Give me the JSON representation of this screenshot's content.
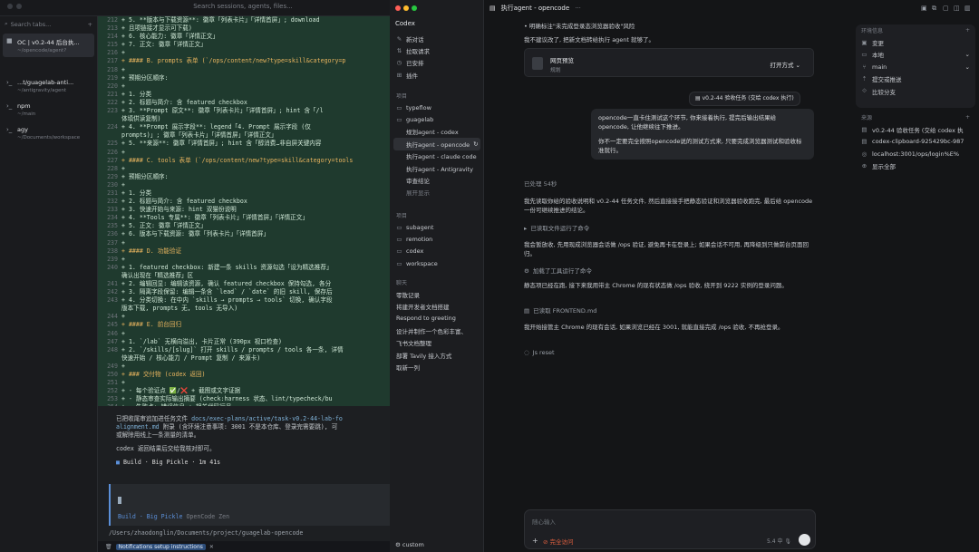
{
  "top_search": "Search sessions, agents, files...",
  "sessions": {
    "search_placeholder": "Search tabs...",
    "items": [
      {
        "title": "OC | v0.2-44 后台执...",
        "sub": "~/opencode/agent?"
      },
      {
        "title": "...t/guagelab-anti...",
        "sub": "~/antigravity/agent"
      },
      {
        "title": "npm",
        "sub": "~/main"
      },
      {
        "title": "agy",
        "sub": "~/Documents/workspace"
      }
    ]
  },
  "diff": [
    {
      "n": "212",
      "t": "+ 5. **版本与下载资源**: 徽章「列表卡片」「详情首屏」; download",
      "k": "add"
    },
    {
      "n": "213",
      "t": "+    且项链接才显示可下载)",
      "k": "add"
    },
    {
      "n": "214",
      "t": "+ 6. 核心能力: 徽章「详情正文」",
      "k": "add"
    },
    {
      "n": "215",
      "t": "+ 7. 正文: 徽章「详情正文」",
      "k": "add"
    },
    {
      "n": "216",
      "t": "+",
      "k": "add"
    },
    {
      "n": "217",
      "t": "+ #### B. prompts 表单 (`/ops/content/new?type=skill&category=p",
      "k": "head"
    },
    {
      "n": "218",
      "t": "+",
      "k": "add"
    },
    {
      "n": "219",
      "t": "+ 预期分区顺序:",
      "k": "add"
    },
    {
      "n": "220",
      "t": "+",
      "k": "add"
    },
    {
      "n": "221",
      "t": "+ 1. 分类",
      "k": "add"
    },
    {
      "n": "222",
      "t": "+ 2. 标题与简介: 含 featured checkbox",
      "k": "add"
    },
    {
      "n": "223",
      "t": "+ 3. **Prompt 原文**: 徽章「列表卡片」「详情首屏」; hint 含「/l",
      "k": "add"
    },
    {
      "n": "",
      "t": "   体填供读复制)",
      "k": "add"
    },
    {
      "n": "224",
      "t": "+ 4. **Prompt 展示字段**: legend「4. Prompt 展示字段 (仅",
      "k": "add"
    },
    {
      "n": "",
      "t": "   prompts)」; 徽章「列表卡片」「详情首屏」「详情正文」",
      "k": "add"
    },
    {
      "n": "225",
      "t": "+ 5. **来源**: 徽章「详情首屏」; hint 含「醇消费…非自屏关键内容",
      "k": "add"
    },
    {
      "n": "226",
      "t": "+",
      "k": "add"
    },
    {
      "n": "227",
      "t": "+ #### C. tools 表单 (`/ops/content/new?type=skill&category=tools",
      "k": "head"
    },
    {
      "n": "228",
      "t": "+",
      "k": "add"
    },
    {
      "n": "229",
      "t": "+ 预期分区顺序:",
      "k": "add"
    },
    {
      "n": "230",
      "t": "+",
      "k": "add"
    },
    {
      "n": "231",
      "t": "+ 1. 分类",
      "k": "add"
    },
    {
      "n": "232",
      "t": "+ 2. 标题与简介: 含 featured checkbox",
      "k": "add"
    },
    {
      "n": "233",
      "t": "+ 3. 快速开始与来源: hint 双猫份说明",
      "k": "add"
    },
    {
      "n": "234",
      "t": "+ 4. **Tools 专属**: 徽章「列表卡片」「详情首屏」「详情正文」",
      "k": "add"
    },
    {
      "n": "235",
      "t": "+ 5. 正文: 徽章「详情正文」",
      "k": "add"
    },
    {
      "n": "236",
      "t": "+ 6. 版本与下载资源: 徽章「列表卡片」「详情首屏」",
      "k": "add"
    },
    {
      "n": "237",
      "t": "+",
      "k": "add"
    },
    {
      "n": "238",
      "t": "+ #### D. 功能验证",
      "k": "head"
    },
    {
      "n": "239",
      "t": "+",
      "k": "add"
    },
    {
      "n": "240",
      "t": "+ 1. featured checkbox: 新建一条 skills 资源勾选「设为精选推荐」",
      "k": "add"
    },
    {
      "n": "",
      "t": "   确认出现在「精选推荐」区",
      "k": "add"
    },
    {
      "n": "241",
      "t": "+ 2. 编辑回显: 编辑该资源, 确认 featured checkbox 保持勾选, 各分",
      "k": "add"
    },
    {
      "n": "242",
      "t": "+ 3. 隔离字段保留: 编辑一条含 `lead` / `date` 的旧 skill, 保存后",
      "k": "add"
    },
    {
      "n": "243",
      "t": "+ 4. 分类切换: 在中内 `skills → prompts → tools` 切换, 确认字段",
      "k": "add"
    },
    {
      "n": "",
      "t": "   版本下载, prompts 无, tools 无导入)",
      "k": "add"
    },
    {
      "n": "244",
      "t": "+",
      "k": "add"
    },
    {
      "n": "245",
      "t": "+ #### E. 前台回归",
      "k": "head"
    },
    {
      "n": "246",
      "t": "+",
      "k": "add"
    },
    {
      "n": "247",
      "t": "+ 1. `/lab` 无横向溢出, 卡片正常 (390px 视口检查)",
      "k": "add"
    },
    {
      "n": "248",
      "t": "+ 2. `/skills/[slug]` 打开 skills / prompts / tools 各一条, 详情",
      "k": "add"
    },
    {
      "n": "",
      "t": "   快速开始 / 核心能力 / Prompt 复制 / 来源卡)",
      "k": "add"
    },
    {
      "n": "249",
      "t": "+",
      "k": "add"
    },
    {
      "n": "250",
      "t": "+ ### 交付物 (codex 返回)",
      "k": "head"
    },
    {
      "n": "251",
      "t": "+",
      "k": "add"
    },
    {
      "n": "252",
      "t": "+ - 每个验证点 ✅/❌ + 截图或文字证据",
      "k": "add"
    },
    {
      "n": "253",
      "t": "+ - 静态审查实际输出摘要 (check:harness 状态、lint/typecheck/bu",
      "k": "add"
    },
    {
      "n": "254",
      "t": "+ - 失败点: 错误信息 + 相关代码行号",
      "k": "add"
    }
  ],
  "term_output": {
    "line1a": "已把收尾审追加进任务文件 ",
    "line1b": "docs/exec-plans/active/task-v0.2-44-lab-fo",
    "line2a": "alignment.md",
    "line2b": " 附录 (含环境注意事项: 3001 不是本仓库、登录完需要跳), 可",
    "line3": "或解除用线上一条测量的清单。",
    "line4": "codex 返回结果后交给我核对即可。",
    "build": "Build · Big Pickle · 1m 41s",
    "prompt_mode": "Build · Big Pickle",
    "prompt_provider": "OpenCode Zen",
    "cwd": "/Users/zhaodonglin/Documents/project/guagelab-opencode"
  },
  "statusbar": {
    "label": "Notifications setup instructions"
  },
  "codex": {
    "title": "Codex",
    "top_items": [
      "新对话",
      "拉取请求",
      "已安排",
      "插件"
    ],
    "section_projects": "项目",
    "projects": [
      {
        "label": "typeflow",
        "indent": false
      },
      {
        "label": "guagelab",
        "indent": false
      },
      {
        "label": "规划agent - codex",
        "indent": true
      },
      {
        "label": "执行agent - opencode",
        "indent": true,
        "selected": true
      },
      {
        "label": "执行agent - claude code",
        "indent": true
      },
      {
        "label": "执行agent - Antigravity",
        "indent": true
      },
      {
        "label": "审查结论",
        "indent": true
      },
      {
        "label": "展开显示",
        "indent": true
      }
    ],
    "section_proj2": "项目",
    "proj2": [
      "subagent",
      "remotion",
      "codex",
      "workspace"
    ],
    "section_chats": "聊天",
    "chats": [
      "零散记录",
      "将建开发者文档搭建",
      "Respond to greeting",
      "设计并制作一个色彩丰富、",
      "飞书文档整理",
      "部署 Tavily 接入方式",
      "取新一列"
    ],
    "bottom": "custom"
  },
  "main": {
    "header_title": "执行agent - opencode",
    "bullet": "明确标注\"未完成登录态浏览器验收\"风险",
    "line_after": "我不建议改了, 把新文档转给执行 agent 就够了。",
    "card_title": "网页预览",
    "card_sub": "规划",
    "card_open": "打开方式",
    "user_chip": "v0.2-44 验收任务 (交给 codex 执行)",
    "bubble1": "opencode一直卡住测试这个环节, 你来接着执行, 提完后输出结果给 opencode, 让他继续往下推进。",
    "bubble2": "你不一定要完全按照opencode说的测试方式来, 只要完成浏览器测试和验收标准就行。",
    "thought": "已处理 54秒",
    "p1": "我先读取你给的验收说明和 v0.2-44 任务文件, 然后直接接手把静态验证和浏览器验收跑完, 最后给 opencode 一份可继续推进的结论。",
    "s1": "已读取文件运行了命令",
    "p2": "我会暂放收, 先用现成浏览器会话做 /ops 验证, 避免再卡在登录上; 如果会话不可用, 再降级到只做前台页面回归。",
    "s2": "加载了工具运行了命令",
    "p3": "静态项已经在跑, 接下来我用带主 Chrome 的现有状态做 /ops 验收, 绕开到 9222 实例的登录问题。",
    "s3": "已读取 FRONTEND.md",
    "p4": "我开始接管主 Chrome 的现有会话, 如果浏览已经在 3001, 就能直接完成 /ops 验收, 不再抢登录。",
    "s4": "Js reset",
    "input_placeholder": "随心输入",
    "input_access": "完全访问",
    "input_right": "5.4 中"
  },
  "rpanel": {
    "env_title": "环境信息",
    "env": [
      "变更",
      "本地",
      "main",
      "提交或推送",
      "比较分支"
    ],
    "src_title": "来源",
    "src": [
      "v0.2-44 验收任务 (交给 codex 执",
      "codex-clipboard-925429bc-987",
      "localhost:3001/ops/login%E%",
      "显示全部"
    ]
  },
  "colors": {
    "add_bg": "#1f3a2e",
    "accent": "#5b8fd8",
    "danger": "#e0603f"
  }
}
